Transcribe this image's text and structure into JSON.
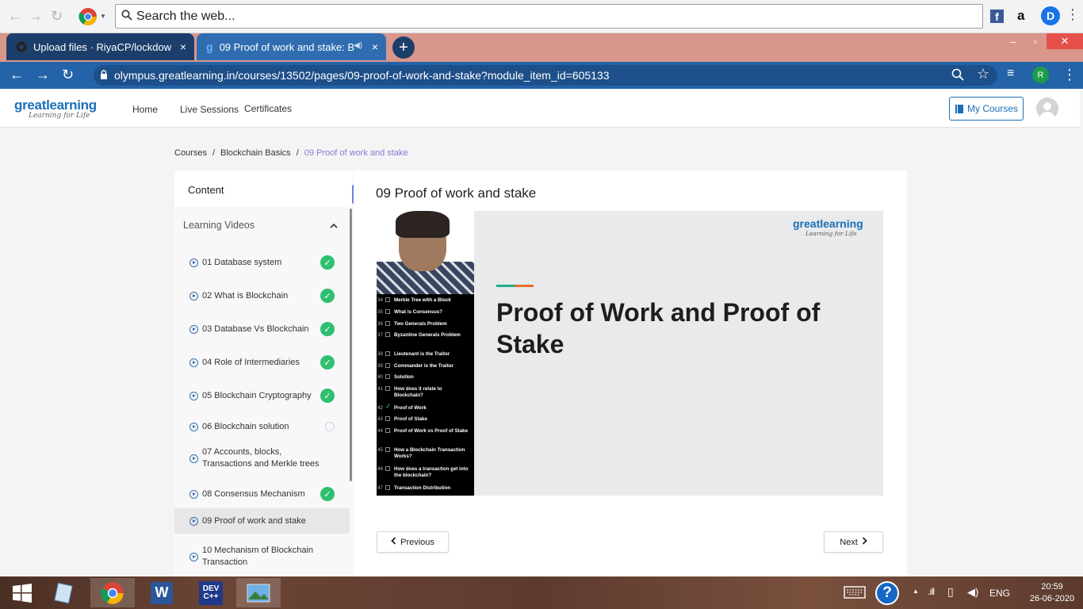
{
  "search": {
    "placeholder": "Search the web..."
  },
  "tabs": [
    {
      "title": "Upload files · RiyaCP/lockdown-c",
      "close": "×"
    },
    {
      "title": "09 Proof of work and stake: B",
      "close": "×"
    }
  ],
  "newtab": "+",
  "window": {
    "minimize": "–",
    "maximize": "▫",
    "close": "✕"
  },
  "address": {
    "url": "olympus.greatlearning.in/courses/13502/pages/09-proof-of-work-and-stake?module_item_id=605133",
    "profile": "R"
  },
  "site": {
    "logo": {
      "name": "greatlearning",
      "tagline": "Learning for Life"
    },
    "nav": [
      "Home",
      "Live Sessions",
      "Certificates"
    ],
    "my_courses": "My Courses"
  },
  "breadcrumb": [
    "Courses",
    "Blockchain Basics",
    "09 Proof of work and stake"
  ],
  "sidebar": {
    "header": "Content",
    "section_title": "Learning Videos",
    "lessons": [
      {
        "label": "01 Database system",
        "done": true
      },
      {
        "label": "02 What is Blockchain",
        "done": true
      },
      {
        "label": "03 Database Vs Blockchain",
        "done": true
      },
      {
        "label": "04 Role of Intermediaries",
        "done": true
      },
      {
        "label": "05 Blockchain Cryptography",
        "done": true
      },
      {
        "label": "06 Blockchain solution",
        "done": false
      },
      {
        "label": "07 Accounts, blocks, Transactions and Merkle trees",
        "done": false
      },
      {
        "label": "08 Consensus Mechanism",
        "done": true
      },
      {
        "label": "09 Proof of work and stake",
        "done": false,
        "active": true
      },
      {
        "label": "10 Mechanism of Blockchain Transaction",
        "done": false
      }
    ]
  },
  "main": {
    "title": "09 Proof of work and stake",
    "video": {
      "slide_title": "Proof of Work and Proof of Stake",
      "logo": "greatlearning",
      "logo_tagline": "Learning for Life",
      "toc": [
        {
          "n": "34",
          "t": "Merkle Tree with a Block",
          "checked": false
        },
        {
          "n": "35",
          "t": "What is Consensus?",
          "checked": false
        },
        {
          "n": "36",
          "t": "Two Generals Problem",
          "checked": false
        },
        {
          "n": "37",
          "t": "Byzantine Generals Problem",
          "checked": false
        },
        {
          "n": "38",
          "t": "Lieutenant is the Traitor",
          "checked": false
        },
        {
          "n": "39",
          "t": "Commander is the Traitor",
          "checked": false
        },
        {
          "n": "40",
          "t": "Solution",
          "checked": false
        },
        {
          "n": "41",
          "t": "How does it relate to Blockchain?",
          "checked": false
        },
        {
          "n": "42",
          "t": "Proof of Work",
          "checked": true
        },
        {
          "n": "43",
          "t": "Proof of Stake",
          "checked": false
        },
        {
          "n": "44",
          "t": "Proof of Work vs Proof of Stake",
          "checked": false
        },
        {
          "n": "45",
          "t": "How a Blockchain Transaction Works?",
          "checked": false
        },
        {
          "n": "46",
          "t": "How does a transaction get into the blockchain?",
          "checked": false
        },
        {
          "n": "47",
          "t": "Transaction Distribution",
          "checked": false
        }
      ]
    },
    "prev_label": "Previous",
    "next_label": "Next"
  },
  "taskbar": {
    "lang": "ENG",
    "time": "20:59",
    "date": "26-06-2020",
    "apps": [
      "Windows",
      "Notepad",
      "Chrome",
      "Word",
      "DEV C++",
      "Photos"
    ]
  },
  "colors": {
    "brand": "#1b6fb6",
    "success": "#2fbf71",
    "accent": "#6f7ee8",
    "chrome_blue": "#2463a8"
  }
}
